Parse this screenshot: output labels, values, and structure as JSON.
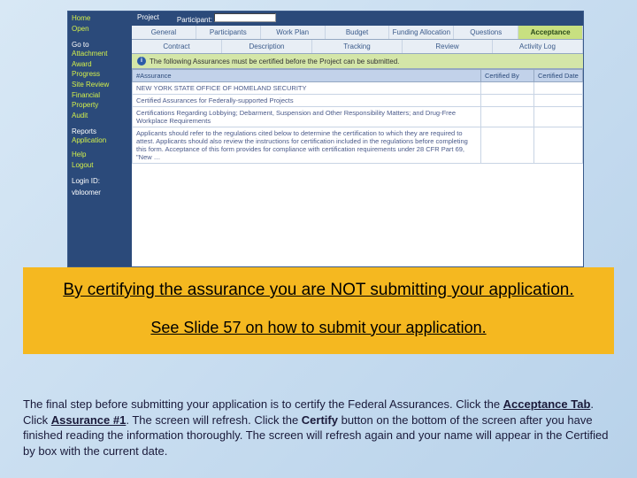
{
  "header": {
    "project_label": "Project",
    "participant_label": "Participant:"
  },
  "sidebar": {
    "items1": [
      "Home",
      "Open"
    ],
    "items2_label": "Go to",
    "items2": [
      "Attachment",
      "Award",
      "Progress",
      "Site Review",
      "Financial",
      "Property",
      "Audit"
    ],
    "items3_label": "Reports",
    "items3": [
      "Application"
    ],
    "items4": [
      "Help",
      "Logout"
    ],
    "login_label": "Login ID:",
    "login_user": "vbloomer"
  },
  "tabs_row1": [
    "General",
    "Participants",
    "Work Plan",
    "Budget",
    "Funding Allocation",
    "Questions",
    "Acceptance"
  ],
  "tabs_row2": [
    "Contract",
    "Description",
    "Tracking",
    "Review",
    "Activity Log"
  ],
  "active_tab": "Acceptance",
  "notice": "The following Assurances must be certified before the Project can be submitted.",
  "table": {
    "col_assurance": "#Assurance",
    "col_certified_by": "Certified By",
    "col_certified_date": "Certified Date",
    "rows": [
      {
        "title": "NEW YORK STATE OFFICE OF HOMELAND SECURITY"
      },
      {
        "title": "Certified Assurances for Federally-supported Projects"
      },
      {
        "title": "Certifications Regarding Lobbying; Debarment, Suspension and Other Responsibility Matters; and Drug-Free Workplace Requirements"
      },
      {
        "title": "Applicants should refer to the regulations cited below to determine the certification to which they are required to attest. Applicants should also review the instructions for certification included in the regulations before completing this form. Acceptance of this form provides for compliance with certification requirements under 28 CFR Part 69, \"New …"
      }
    ]
  },
  "callout": {
    "line1": "By certifying the assurance you are NOT submitting your application.",
    "line2": "See Slide 57 on how to submit your application."
  },
  "instructions": {
    "t1": "The final step before submitting your application is to certify the Federal Assurances.  Click the ",
    "t2": "Acceptance Tab",
    "t3": ".  Click ",
    "t4": "Assurance #1",
    "t5": ".  The screen will refresh.  Click the ",
    "t6": "Certify",
    "t7": " button on the bottom of the screen after you have finished reading the information thoroughly.  The screen will refresh again and your name will appear in the Certified by box with the current date."
  }
}
